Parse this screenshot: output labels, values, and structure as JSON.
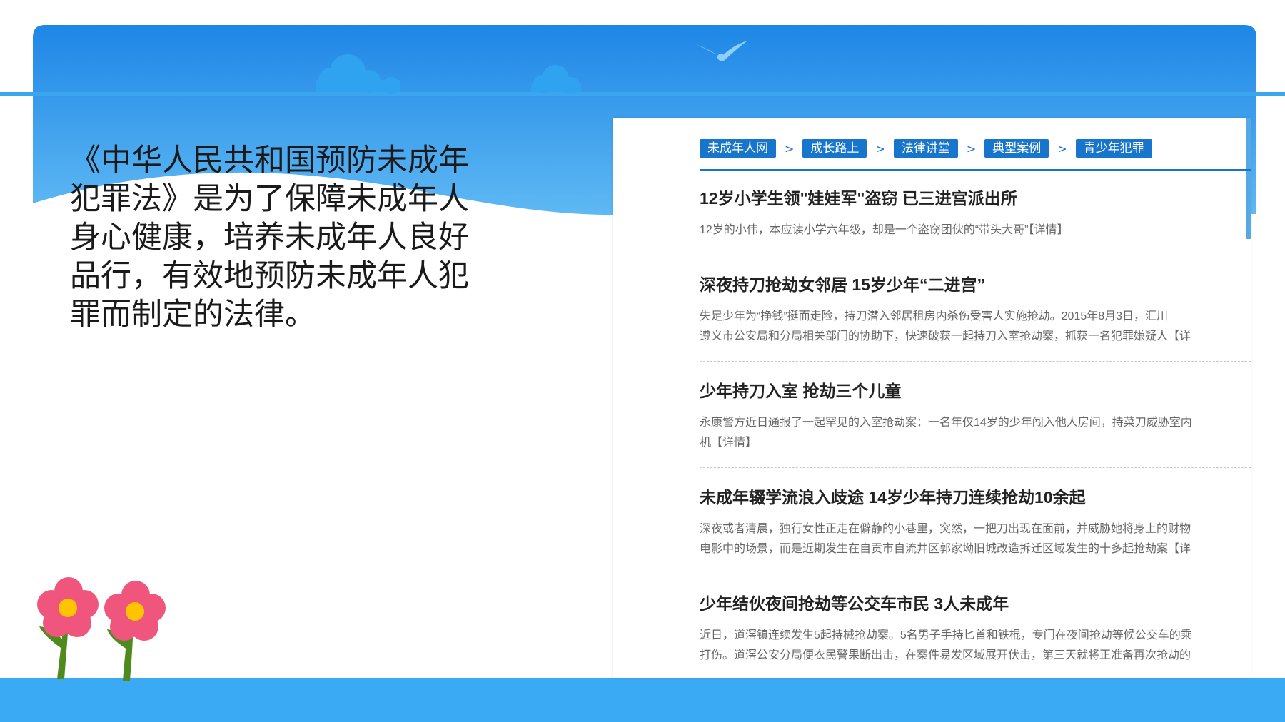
{
  "slide": {
    "intro_text": "《中华人民共和国预防未成年犯罪法》是为了保障未成年人身心健康，培养未成年人良好品行，有效地预防未成年人犯罪而制定的法律。"
  },
  "screenshot": {
    "breadcrumb": [
      "未成年人网",
      "成长路上",
      "法律讲堂",
      "典型案例",
      "青少年犯罪"
    ],
    "breadcrumb_separator": ">",
    "news": [
      {
        "title": "12岁小学生领\"娃娃军\"盗窃 已三进宫派出所",
        "lines": [
          "12岁的小伟，本应读小学六年级，却是一个盗窃团伙的“带头大哥”【详情】"
        ]
      },
      {
        "title": "深夜持刀抢劫女邻居 15岁少年“二进宫”",
        "lines": [
          "失足少年为“挣钱”挺而走险，持刀潜入邻居租房内杀伤受害人实施抢劫。2015年8月3日，汇川",
          "遵义市公安局和分局相关部门的协助下，快速破获一起持刀入室抢劫案，抓获一名犯罪嫌疑人【详"
        ]
      },
      {
        "title": "少年持刀入室 抢劫三个儿童",
        "lines": [
          "永康警方近日通报了一起罕见的入室抢劫案：一名年仅14岁的少年闯入他人房间，持菜刀威胁室内",
          "机【详情】"
        ]
      },
      {
        "title": "未成年辍学流浪入歧途 14岁少年持刀连续抢劫10余起",
        "lines": [
          "深夜或者清晨，独行女性正走在僻静的小巷里，突然，一把刀出现在面前，并威胁她将身上的财物",
          "电影中的场景，而是近期发生在自贡市自流井区郭家坳旧城改造拆迁区域发生的十多起抢劫案【详"
        ]
      },
      {
        "title": "少年结伙夜间抢劫等公交车市民 3人未成年",
        "lines": [
          "近日，道滘镇连续发生5起持械抢劫案。5名男子手持匕首和铁棍，专门在夜间抢劫等候公交车的乘",
          "打伤。道滘公安分局便衣民警果断出击，在案件易发区域展开伏击，第三天就将正准备再次抢劫的"
        ]
      }
    ]
  },
  "colors": {
    "header_top": "#1e86e6",
    "header_bottom": "#68c0f5",
    "footer": "#3aaaf4",
    "breadcrumb": "#1776cc",
    "flower_petal": "#f0557d",
    "flower_center": "#ffc400",
    "stem": "#4f8a1e"
  },
  "icons": [
    "cloud-icon",
    "bird-icon",
    "flower-icon"
  ]
}
